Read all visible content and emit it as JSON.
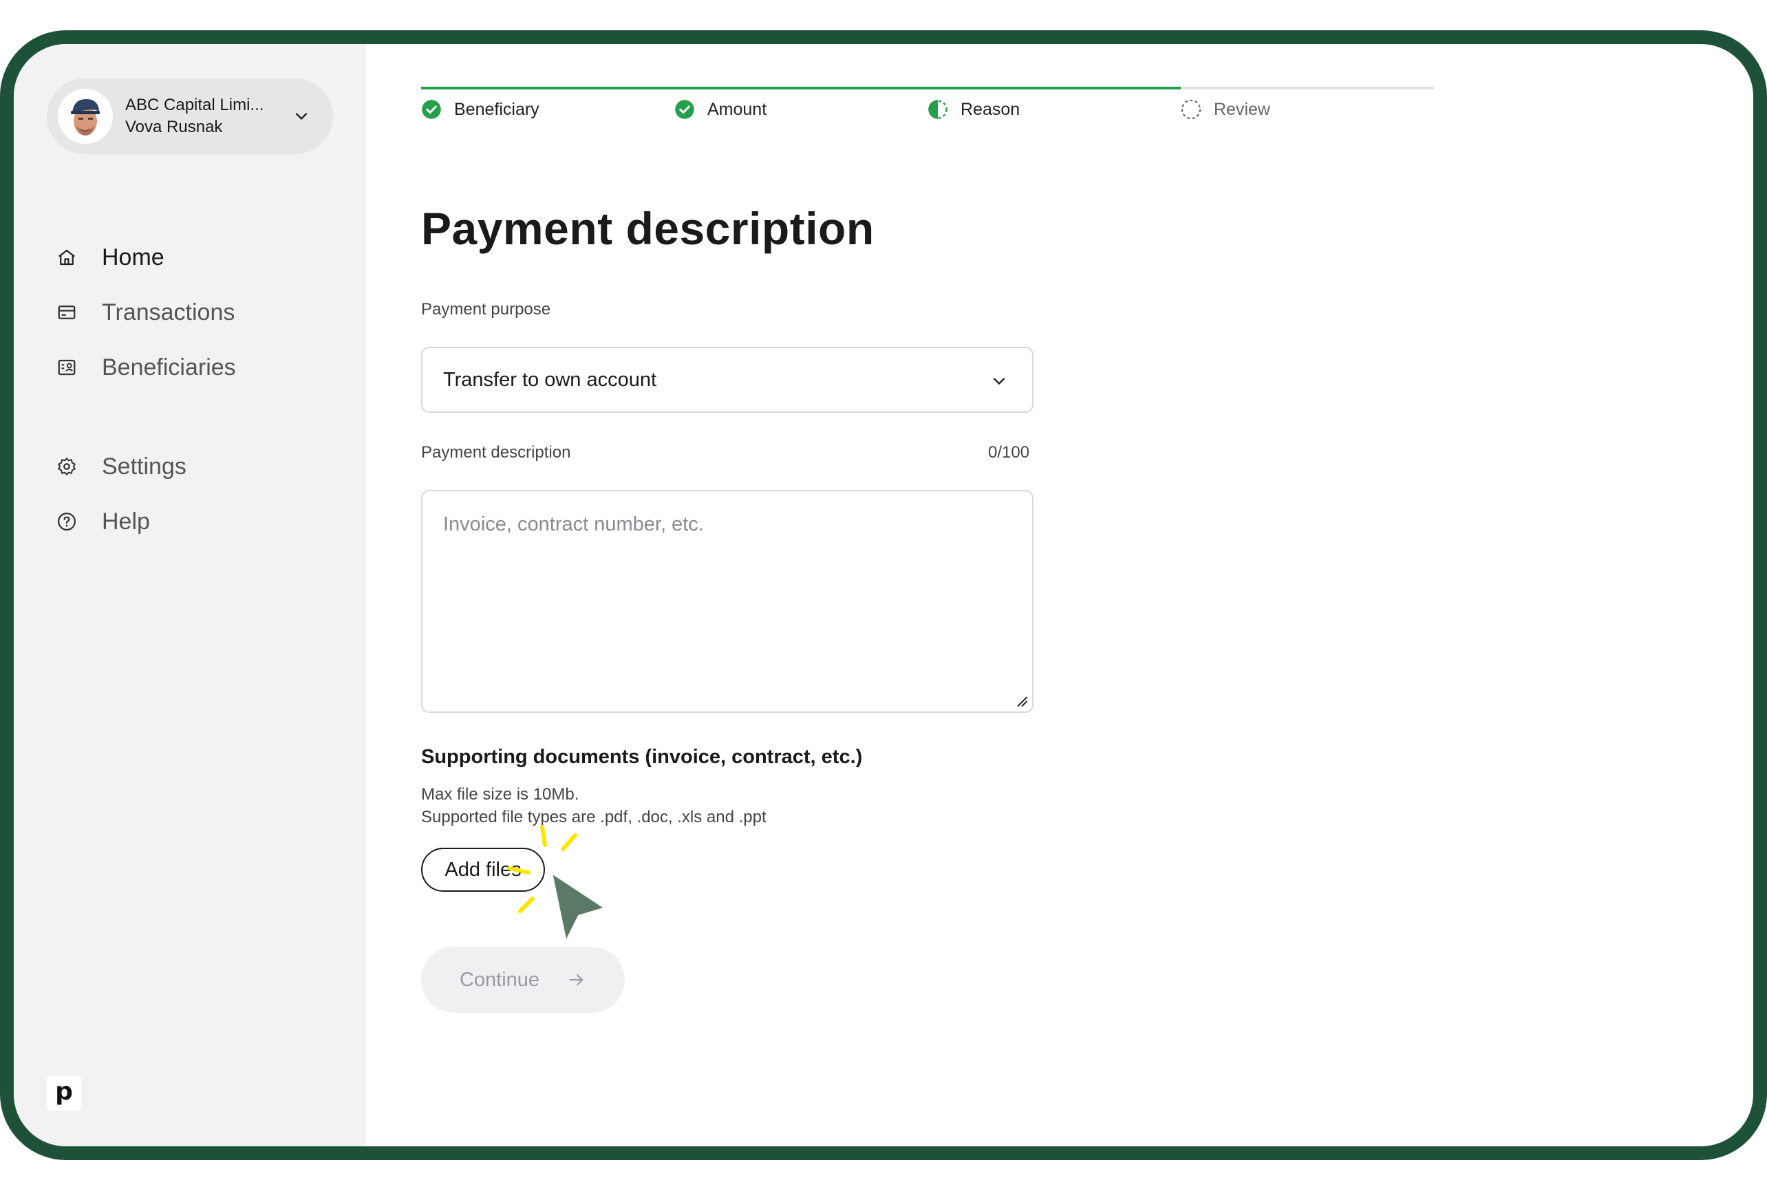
{
  "account": {
    "company": "ABC Capital Limi...",
    "user": "Vova Rusnak"
  },
  "nav": {
    "items": [
      {
        "label": "Home",
        "icon": "home-icon",
        "active": true
      },
      {
        "label": "Transactions",
        "icon": "card-icon",
        "active": false
      },
      {
        "label": "Beneficiaries",
        "icon": "contact-card-icon",
        "active": false
      }
    ],
    "secondary": [
      {
        "label": "Settings",
        "icon": "gear-icon"
      },
      {
        "label": "Help",
        "icon": "help-circle-icon"
      }
    ]
  },
  "brand": {
    "logo": "p"
  },
  "stepper": {
    "progress": 0.75,
    "steps": [
      {
        "label": "Beneficiary",
        "state": "complete"
      },
      {
        "label": "Amount",
        "state": "complete"
      },
      {
        "label": "Reason",
        "state": "in-progress"
      },
      {
        "label": "Review",
        "state": "pending"
      }
    ]
  },
  "page": {
    "title": "Payment description"
  },
  "purpose": {
    "label": "Payment purpose",
    "selected": "Transfer to own account"
  },
  "description": {
    "label": "Payment description",
    "counter": "0/100",
    "placeholder": "Invoice, contract number, etc.",
    "value": ""
  },
  "documents": {
    "title": "Supporting documents (invoice, contract, etc.)",
    "note_size": "Max file size is 10Mb.",
    "note_types": "Supported file types are .pdf, .doc, .xls and .ppt",
    "add_label": "Add files"
  },
  "actions": {
    "continue_label": "Continue"
  },
  "colors": {
    "frame": "#1e5238",
    "accent_green": "#24a04a",
    "sidebar_bg": "#f2f2f4",
    "cursor": "#5a7a66",
    "highlight": "#ffe600"
  }
}
